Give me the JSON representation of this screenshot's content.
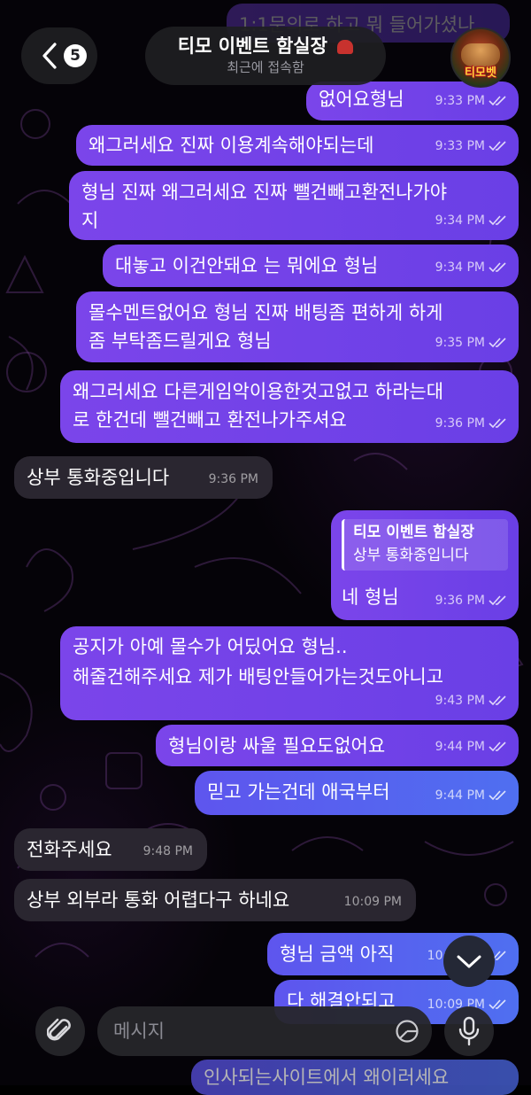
{
  "header": {
    "title": "티모 이벤트 함실장",
    "status": "최근에 접속함",
    "unread_count": "5",
    "avatar_text": "티모벳"
  },
  "messages": [
    {
      "text": "1:1문의로 하고 뭐 들어가셨나",
      "time": "",
      "dir": "out"
    },
    {
      "text": "없어요형님",
      "time": "9:33 PM",
      "dir": "out"
    },
    {
      "text": "왜그러세요 진짜 이용계속해야되는데",
      "time": "9:33 PM",
      "dir": "out"
    },
    {
      "text": "형님 진짜 왜그러세요 진짜 뺄건빼고환전나가야\n지",
      "time": "9:34 PM",
      "dir": "out"
    },
    {
      "text": "대놓고 이건안돼요 는 뭐에요 형님",
      "time": "9:34 PM",
      "dir": "out"
    },
    {
      "text": "몰수멘트없어요 형님 진짜 배팅좀 편하게 하게\n좀 부탁좀드릴게요 형님",
      "time": "9:35 PM",
      "dir": "out"
    },
    {
      "text": "왜그러세요 다른게임악이용한것고없고 하라는대\n로 한건데 뺄건빼고 환전나가주셔요",
      "time": "9:36 PM",
      "dir": "out"
    },
    {
      "text": "상부 통화중입니다",
      "time": "9:36 PM",
      "dir": "in"
    },
    {
      "quote_author": "티모 이벤트 함실장",
      "quote_text": "상부 통화중입니다",
      "text": "네 형님",
      "time": "9:36 PM",
      "dir": "out"
    },
    {
      "text": "공지가 아예 몰수가 어딨어요 형님..\n해줄건해주세요 제가 배팅안들어가는것도아니고",
      "time": "9:43 PM",
      "dir": "out"
    },
    {
      "text": "형님이랑 싸울 필요도없어요",
      "time": "9:44 PM",
      "dir": "out"
    },
    {
      "text": "믿고 가는건데 애국부터",
      "time": "9:44 PM",
      "dir": "out"
    },
    {
      "text": "전화주세요",
      "time": "9:48 PM",
      "dir": "in"
    },
    {
      "text": "상부 외부라 통화 어렵다구 하네요",
      "time": "10:09 PM",
      "dir": "in"
    },
    {
      "text": "형님 금액 아직",
      "time": "10:09 PM",
      "dir": "out"
    },
    {
      "text": "다 해결안되고",
      "time": "10:09 PM",
      "dir": "out"
    },
    {
      "text": "인사되는사이트에서 왜이러세요",
      "time": "",
      "dir": "out"
    }
  ],
  "composer": {
    "placeholder": "메시지"
  },
  "colors": {
    "outgoing": "#7044e8",
    "outgoing_blue": "#5562ef",
    "incoming": "#2a2630",
    "background": "#050308"
  },
  "icons": [
    "back-chevron-icon",
    "attach-paperclip-icon",
    "sticker-icon",
    "microphone-icon",
    "scroll-down-chevron-icon",
    "read-ticks-icon"
  ]
}
